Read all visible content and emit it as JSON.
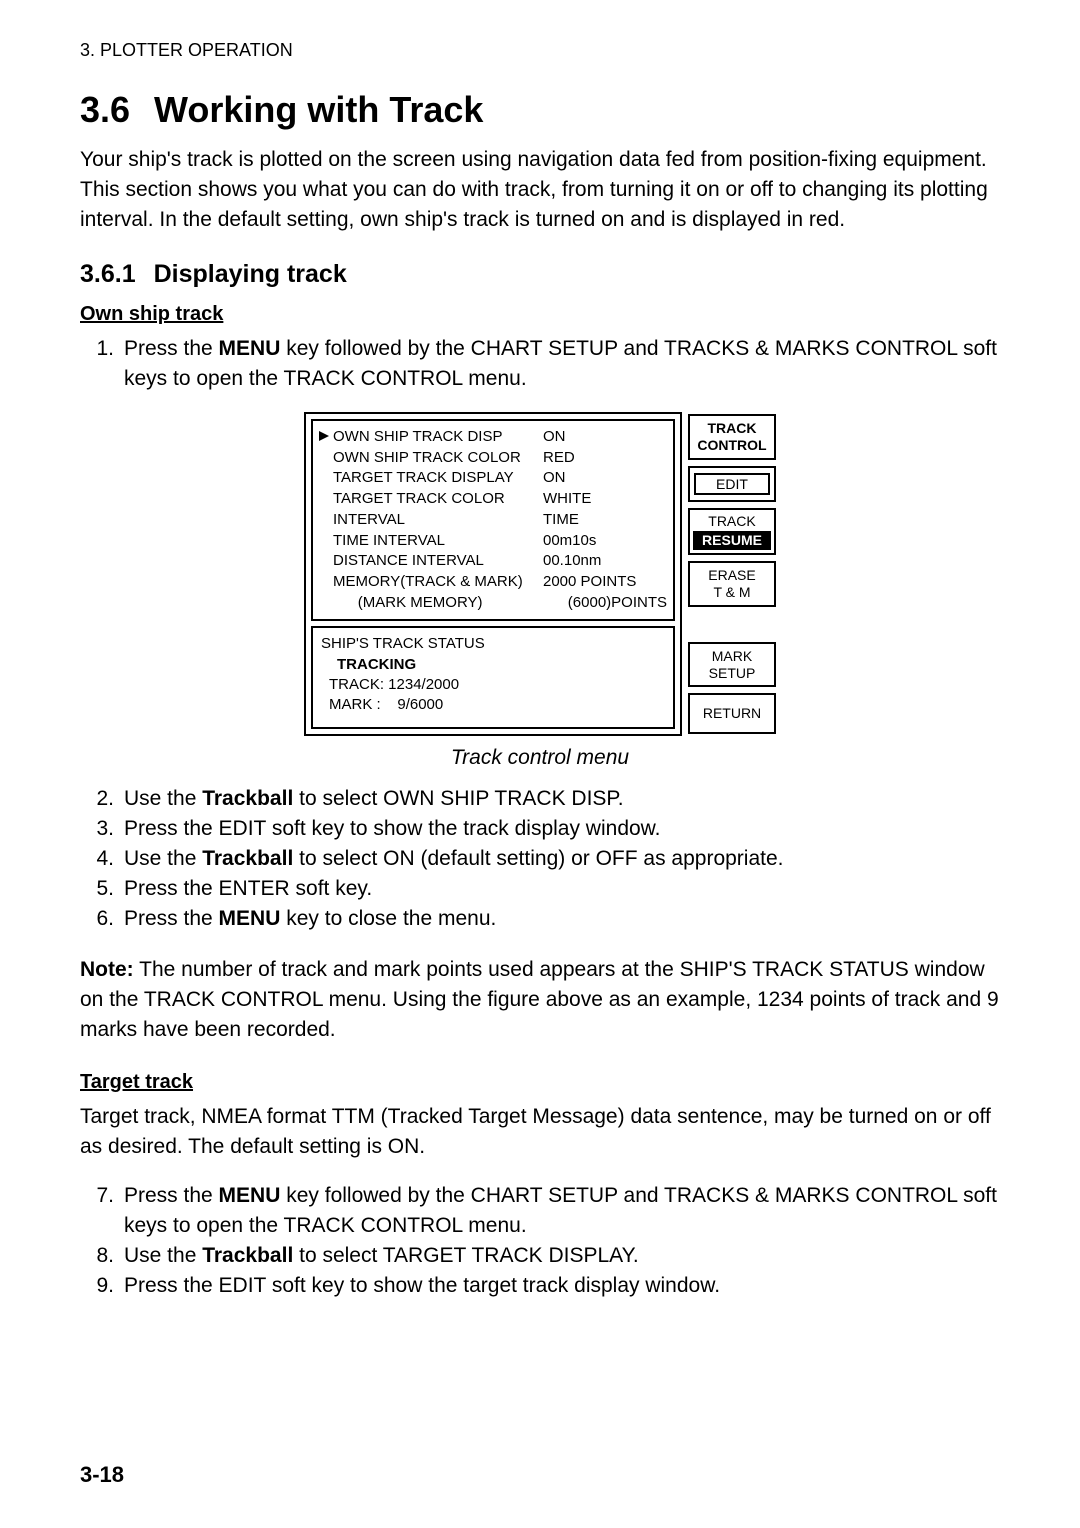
{
  "header": "3. PLOTTER OPERATION",
  "h1_num": "3.6",
  "h1_title": "Working with Track",
  "intro": "Your ship's track is plotted on the screen using navigation data fed from position-fixing equipment. This section shows you what you can do with track, from turning it on or off to changing its plotting interval. In the default setting, own ship's track is turned on and is displayed in red.",
  "h2_num": "3.6.1",
  "h2_title": "Displaying track",
  "own_ship_head": "Own ship track",
  "step1_n": "1.",
  "step1_a": "Press the ",
  "step1_b": "MENU",
  "step1_c": " key followed by the CHART SETUP and TRACKS & MARKS CONTROL soft keys to open the TRACK CONTROL menu.",
  "menu_rows": [
    {
      "key": "OWN SHIP TRACK DISP",
      "val": "ON",
      "arrow": true
    },
    {
      "key": "OWN SHIP TRACK COLOR",
      "val": "RED"
    },
    {
      "key": "TARGET TRACK DISPLAY",
      "val": "ON"
    },
    {
      "key": "TARGET TRACK COLOR",
      "val": "WHITE"
    },
    {
      "key": "INTERVAL",
      "val": "TIME"
    },
    {
      "key": "TIME INTERVAL",
      "val": "00m10s"
    },
    {
      "key": "DISTANCE INTERVAL",
      "val": "00.10nm"
    },
    {
      "key": "MEMORY(TRACK & MARK)",
      "val": "2000 POINTS"
    },
    {
      "key": "(MARK MEMORY)",
      "val": "(6000)POINTS",
      "indent": true
    }
  ],
  "status1": "SHIP'S TRACK STATUS",
  "status2": "TRACKING",
  "status3": "TRACK: 1234/2000",
  "status4a": "MARK :",
  "status4b": "9/6000",
  "rbtn1a": "TRACK",
  "rbtn1b": "CONTROL",
  "rbtn2": "EDIT",
  "rbtn3a": "TRACK",
  "rbtn3b": "RESUME",
  "rbtn4a": "ERASE",
  "rbtn4b": "T & M",
  "rbtn5a": "MARK",
  "rbtn5b": "SETUP",
  "rbtn6": "RETURN",
  "fig_caption": "Track control menu",
  "step2_n": "2.",
  "step2_a": "Use the ",
  "step2_b": "Trackball",
  "step2_c": " to select OWN SHIP TRACK DISP.",
  "step3_n": "3.",
  "step3_t": "Press the EDIT soft key to show the track display window.",
  "step4_n": "4.",
  "step4_a": "Use the ",
  "step4_b": "Trackball",
  "step4_c": " to select ON (default setting) or OFF as appropriate.",
  "step5_n": "5.",
  "step5_t": "Press the ENTER soft key.",
  "step6_n": "6.",
  "step6_a": "Press the ",
  "step6_b": "MENU",
  "step6_c": " key to close the menu.",
  "note_a": "Note:",
  "note_b": " The number of track and mark points used appears at the SHIP'S TRACK STATUS window on the TRACK CONTROL menu. Using the figure above as an example, 1234 points of track and 9 marks have been recorded.",
  "target_head": "Target track",
  "target_para": "Target track, NMEA format TTM (Tracked Target Message) data sentence, may be turned on or off as desired. The default setting is ON.",
  "step7_n": "7.",
  "step7_a": "Press the ",
  "step7_b": "MENU",
  "step7_c": " key followed by the CHART SETUP and TRACKS & MARKS CONTROL soft keys to open the TRACK CONTROL menu.",
  "step8_n": "8.",
  "step8_a": "Use the ",
  "step8_b": "Trackball",
  "step8_c": " to select TARGET TRACK DISPLAY.",
  "step9_n": "9.",
  "step9_t": "Press the EDIT soft key to show the target track display window.",
  "page_number": "3-18"
}
